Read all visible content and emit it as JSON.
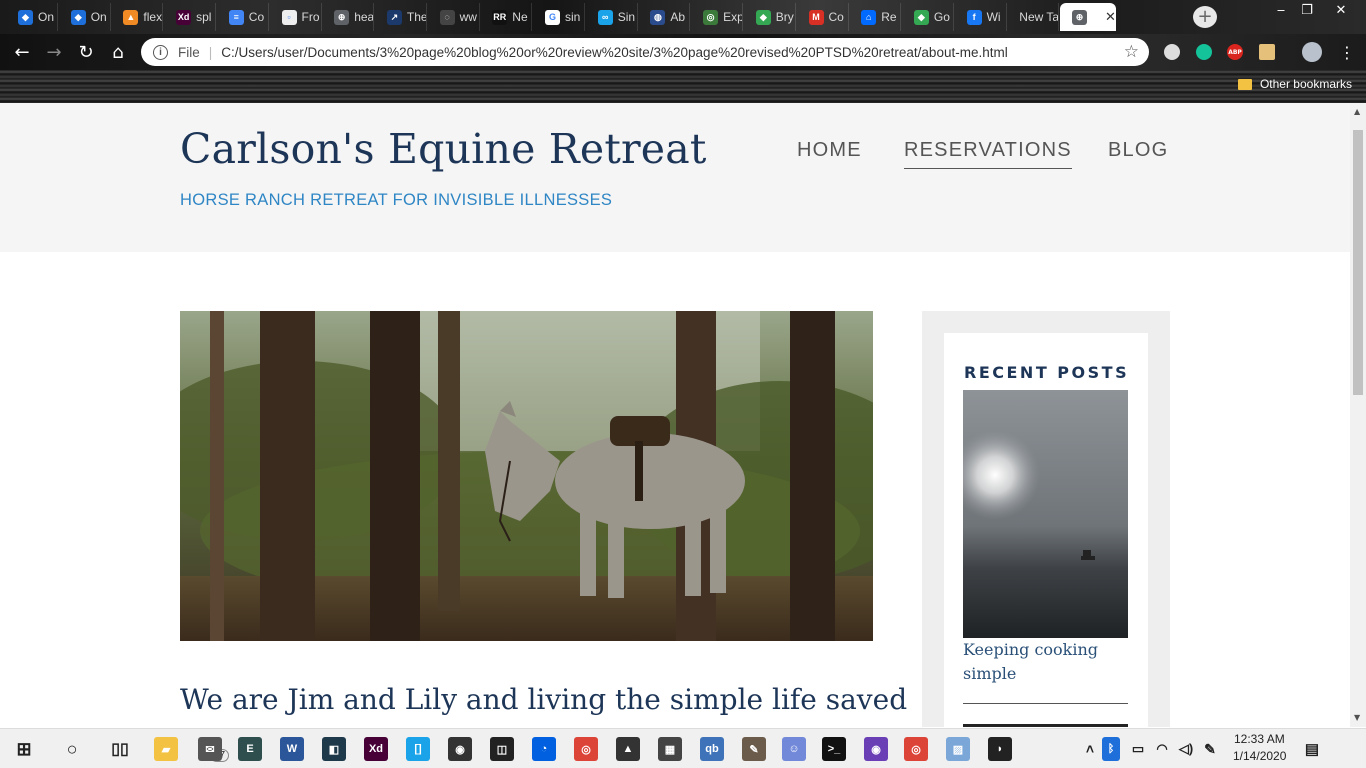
{
  "browser": {
    "tabs": [
      {
        "label": "On",
        "color": "#1e6fd9",
        "glyph": "◆"
      },
      {
        "label": "On",
        "color": "#1e6fd9",
        "glyph": "◆"
      },
      {
        "label": "flex",
        "color": "#f08a24",
        "glyph": "▲"
      },
      {
        "label": "spl",
        "color": "#470137",
        "glyph": "Xd"
      },
      {
        "label": "Co",
        "color": "#4285f4",
        "glyph": "≡"
      },
      {
        "label": "Fro",
        "color": "#eeeeee",
        "glyph": "▫"
      },
      {
        "label": "hea",
        "color": "#5f6368",
        "glyph": "⊕"
      },
      {
        "label": "The",
        "color": "#1b3a6b",
        "glyph": "↗"
      },
      {
        "label": "ww",
        "color": "#444444",
        "glyph": "◌"
      },
      {
        "label": "Ne",
        "color": "#111111",
        "glyph": "RR"
      },
      {
        "label": "sin",
        "color": "#ffffff",
        "glyph": "G"
      },
      {
        "label": "Sin",
        "color": "#1aa3e8",
        "glyph": "∞"
      },
      {
        "label": "Ab",
        "color": "#2b4c8c",
        "glyph": "◍"
      },
      {
        "label": "Exp",
        "color": "#3b7a3b",
        "glyph": "◎"
      },
      {
        "label": "Bry",
        "color": "#34a853",
        "glyph": "◆"
      },
      {
        "label": "Co",
        "color": "#d93025",
        "glyph": "M"
      },
      {
        "label": "Re",
        "color": "#006aff",
        "glyph": "⌂"
      },
      {
        "label": "Go",
        "color": "#34a853",
        "glyph": "◆"
      },
      {
        "label": "Wi",
        "color": "#1877f2",
        "glyph": "f"
      },
      {
        "label": "New Ta",
        "color": "",
        "glyph": ""
      },
      {
        "label": "",
        "color": "#5f6368",
        "glyph": "⊕",
        "active": true
      }
    ],
    "address": {
      "scheme": "File",
      "url": "C:/Users/user/Documents/3%20page%20blog%20or%20review%20site/3%20page%20revised%20PTSD%20retreat/about-me.html"
    },
    "other_bookmarks": "Other bookmarks",
    "extensions": [
      {
        "name": "half-moon-icon",
        "color": "#dddddd"
      },
      {
        "name": "grammarly-icon",
        "color": "#15c39a"
      },
      {
        "name": "adblock-plus-icon",
        "color": "#d9251d",
        "text": "ABP"
      },
      {
        "name": "extension-icon",
        "color": "#e5c07b"
      },
      {
        "name": "profile-avatar",
        "color": "#b9c2cc"
      }
    ]
  },
  "site": {
    "title": "Carlson's Equine Retreat",
    "tagline": "HORSE RANCH RETREAT FOR INVISIBLE ILLNESSES",
    "nav": [
      {
        "label": "HOME",
        "current": false
      },
      {
        "label": "RESERVATIONS",
        "current": true
      },
      {
        "label": "BLOG",
        "current": false
      }
    ],
    "intro_heading": "We are Jim and Lily and living the simple life saved",
    "sidebar": {
      "title": "RECENT POSTS",
      "posts": [
        {
          "title": "Keeping cooking simple"
        }
      ]
    }
  },
  "taskbar": {
    "badge_count": "57",
    "time": "12:33 AM",
    "date": "1/14/2020",
    "apps": [
      {
        "name": "file-explorer-icon",
        "color": "#f3c243",
        "glyph": "▰"
      },
      {
        "name": "mail-app-icon",
        "color": "#555555",
        "glyph": "✉"
      },
      {
        "name": "app-e-icon",
        "color": "#2f4f4f",
        "glyph": "E"
      },
      {
        "name": "word-icon",
        "color": "#2b579a",
        "glyph": "W"
      },
      {
        "name": "app-dark-icon",
        "color": "#1e3a4a",
        "glyph": "◧"
      },
      {
        "name": "adobe-xd-icon",
        "color": "#470137",
        "glyph": "Xd"
      },
      {
        "name": "brackets-icon",
        "color": "#1aa3e8",
        "glyph": "[]"
      },
      {
        "name": "app-color-icon",
        "color": "#333333",
        "glyph": "◉"
      },
      {
        "name": "app-box-icon",
        "color": "#222222",
        "glyph": "◫"
      },
      {
        "name": "firefox-icon",
        "color": "#0060df",
        "glyph": "◔"
      },
      {
        "name": "chrome-icon",
        "color": "#db4437",
        "glyph": "◎"
      },
      {
        "name": "inkscape-icon",
        "color": "#333333",
        "glyph": "▲"
      },
      {
        "name": "calculator-icon",
        "color": "#444444",
        "glyph": "▦"
      },
      {
        "name": "qbittorrent-icon",
        "color": "#3e73b9",
        "glyph": "qb"
      },
      {
        "name": "gimp-icon",
        "color": "#6b5b4b",
        "glyph": "✎"
      },
      {
        "name": "discord-icon",
        "color": "#7289da",
        "glyph": "☺"
      },
      {
        "name": "terminal-icon",
        "color": "#111111",
        "glyph": ">_"
      },
      {
        "name": "podcast-app-icon",
        "color": "#6a3fb5",
        "glyph": "◉"
      },
      {
        "name": "chrome-icon-2",
        "color": "#db4437",
        "glyph": "◎"
      },
      {
        "name": "image-viewer-icon",
        "color": "#7aa7d8",
        "glyph": "▨"
      },
      {
        "name": "app-car-icon",
        "color": "#222222",
        "glyph": "◗"
      }
    ]
  }
}
